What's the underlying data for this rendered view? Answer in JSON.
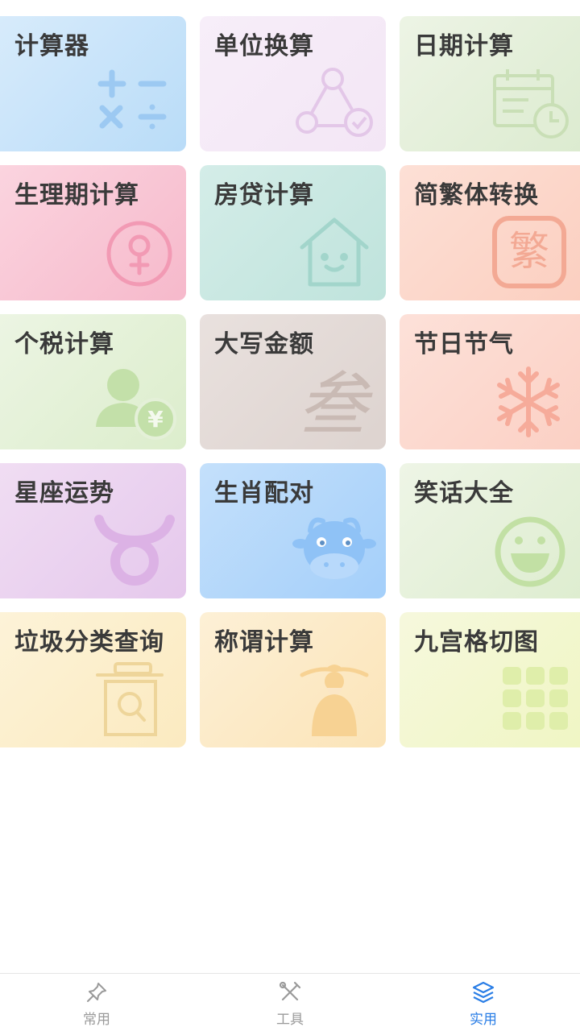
{
  "tools": [
    {
      "label": "计算器",
      "icon": "calculator-icon",
      "bg_from": "#d7ebfb",
      "bg_to": "#b9dcf8",
      "icon_color": "#9cc9f2"
    },
    {
      "label": "单位换算",
      "icon": "unit-convert-icon",
      "bg_from": "#f7eef9",
      "bg_to": "#f3e6f5",
      "icon_color": "#e3c7e8"
    },
    {
      "label": "日期计算",
      "icon": "calendar-clock-icon",
      "bg_from": "#edf4e5",
      "bg_to": "#dcebd0",
      "icon_color": "#c9dfb6"
    },
    {
      "label": "生理期计算",
      "icon": "female-symbol-icon",
      "bg_from": "#fbd4df",
      "bg_to": "#f6b9cb",
      "icon_color": "#f29ab4"
    },
    {
      "label": "房贷计算",
      "icon": "house-icon",
      "bg_from": "#d4ede8",
      "bg_to": "#bfe3dc",
      "icon_color": "#a2d5cb"
    },
    {
      "label": "简繁体转换",
      "icon": "traditional-char-icon",
      "bg_from": "#fde0d6",
      "bg_to": "#fbcfc0",
      "icon_color": "#f3a994",
      "glyph": "繁"
    },
    {
      "label": "个税计算",
      "icon": "person-yuan-icon",
      "bg_from": "#ecf5e3",
      "bg_to": "#dcedcc",
      "icon_color": "#c3e0a9",
      "glyph": "¥"
    },
    {
      "label": "大写金额",
      "icon": "uppercase-number-icon",
      "bg_from": "#e9e1de",
      "bg_to": "#ddd3cf",
      "icon_color": "#c9bab4",
      "glyph": "叁"
    },
    {
      "label": "节日节气",
      "icon": "snowflake-icon",
      "bg_from": "#fde1d9",
      "bg_to": "#fbd0c4",
      "icon_color": "#f6ab9a"
    },
    {
      "label": "星座运势",
      "icon": "taurus-icon",
      "bg_from": "#f0ddf3",
      "bg_to": "#e5c8ec",
      "icon_color": "#dcb2e5"
    },
    {
      "label": "生肖配对",
      "icon": "ox-icon",
      "bg_from": "#c4e0fb",
      "bg_to": "#a4cffa",
      "icon_color": "#8fc2f6"
    },
    {
      "label": "笑话大全",
      "icon": "smiley-icon",
      "bg_from": "#eef5e6",
      "bg_to": "#deedd0",
      "icon_color": "#c2e0a4"
    },
    {
      "label": "垃圾分类查询",
      "icon": "trash-search-icon",
      "bg_from": "#fdf3d8",
      "bg_to": "#fbeac0",
      "icon_color": "#eed59a"
    },
    {
      "label": "称谓计算",
      "icon": "elder-figure-icon",
      "bg_from": "#fdf0d6",
      "bg_to": "#fbe4b8",
      "icon_color": "#f7d293"
    },
    {
      "label": "九宫格切图",
      "icon": "nine-grid-icon",
      "bg_from": "#f6f8dd",
      "bg_to": "#f0f6c4",
      "icon_color": "#dfeeaa"
    }
  ],
  "tabbar": {
    "tabs": [
      {
        "label": "常用",
        "icon": "pin-icon",
        "active": false
      },
      {
        "label": "工具",
        "icon": "tools-icon",
        "active": false
      },
      {
        "label": "实用",
        "icon": "layers-icon",
        "active": true
      }
    ],
    "active_color": "#2a7ee6",
    "inactive_color": "#9a9a9a"
  }
}
